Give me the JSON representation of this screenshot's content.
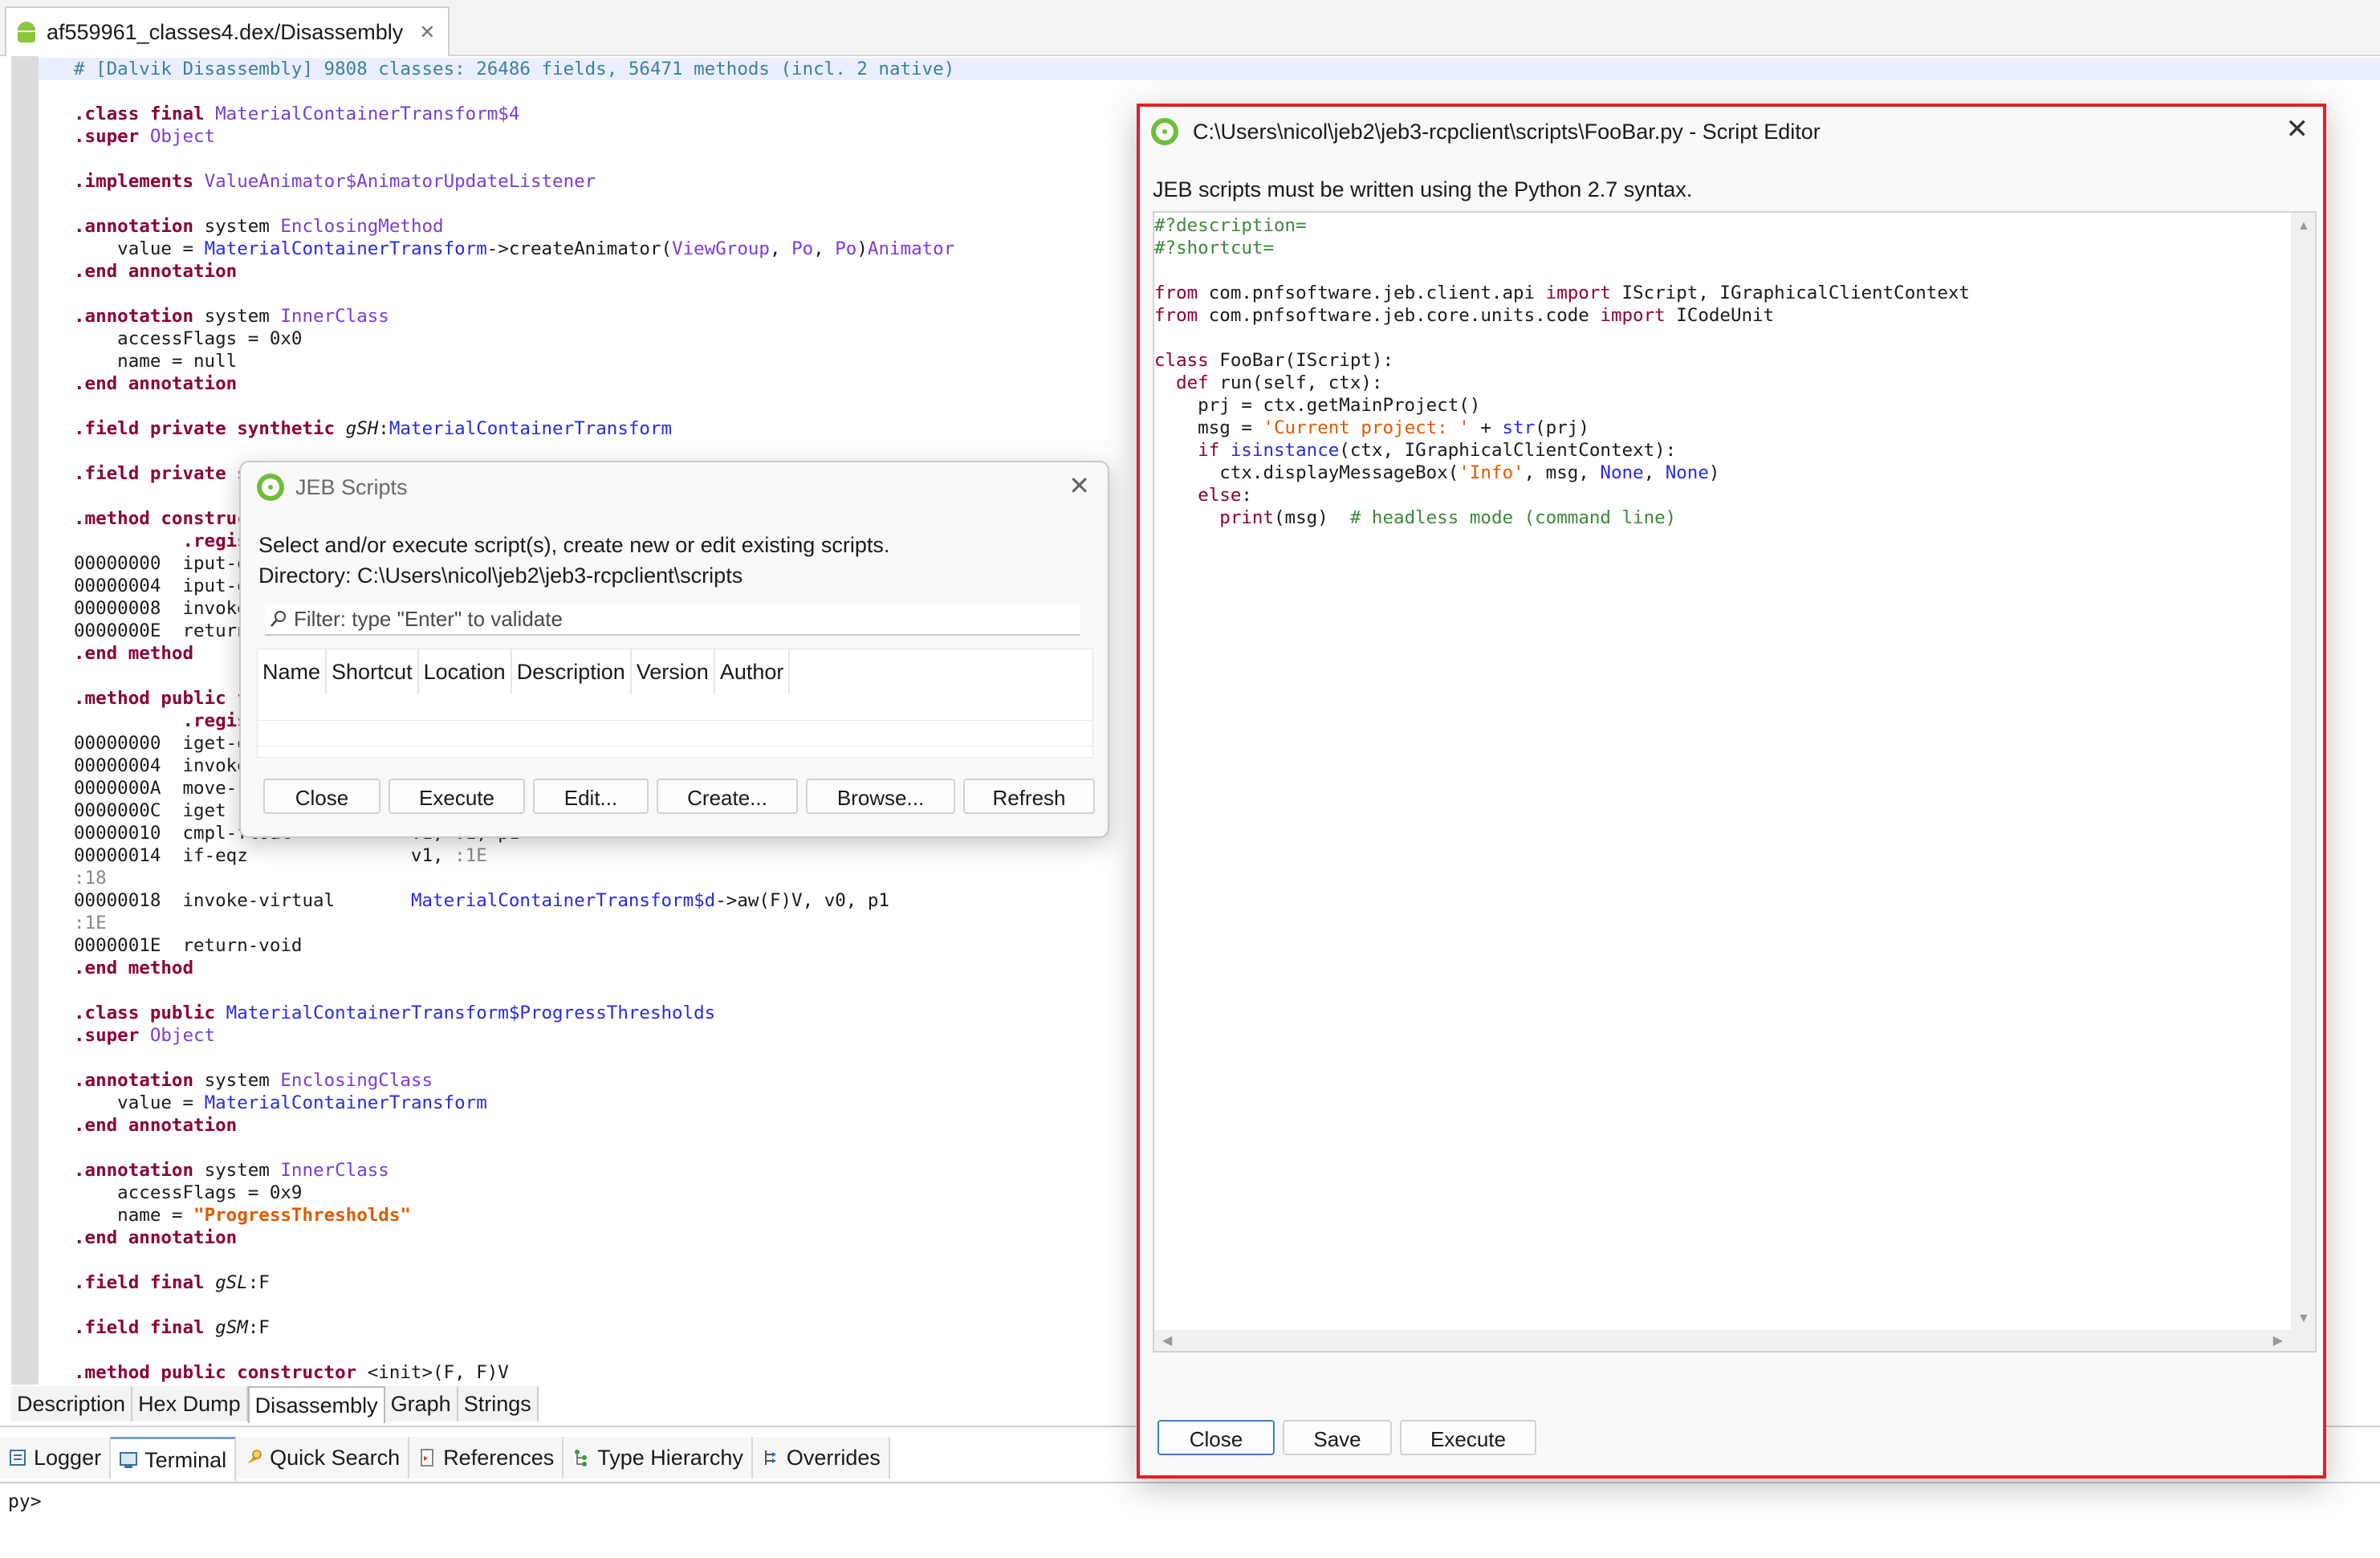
{
  "editor_tab": {
    "title": "af559961_classes4.dex/Disassembly",
    "close": "✕"
  },
  "code": {
    "lines": [
      [
        {
          "t": "# [Dalvik Disassembly] 9808 classes: 26486 fields, 56471 methods (incl. 2 native)",
          "c": "cmt"
        }
      ],
      [],
      [
        {
          "t": ".class final ",
          "c": "kw"
        },
        {
          "t": "MaterialContainerTransform$4",
          "c": "ty"
        }
      ],
      [
        {
          "t": ".super ",
          "c": "kw"
        },
        {
          "t": "Object",
          "c": "ty"
        }
      ],
      [],
      [
        {
          "t": ".implements ",
          "c": "kw"
        },
        {
          "t": "ValueAnimator$AnimatorUpdateListener",
          "c": "ty"
        }
      ],
      [],
      [
        {
          "t": ".annotation ",
          "c": "kw"
        },
        {
          "t": "system "
        },
        {
          "t": "EnclosingMethod",
          "c": "ty"
        }
      ],
      [
        {
          "t": "    value = "
        },
        {
          "t": "MaterialContainerTransform",
          "c": "sc"
        },
        {
          "t": "->createAnimator("
        },
        {
          "t": "ViewGroup",
          "c": "ty"
        },
        {
          "t": ", "
        },
        {
          "t": "Po",
          "c": "ty"
        },
        {
          "t": ", "
        },
        {
          "t": "Po",
          "c": "ty"
        },
        {
          "t": ")"
        },
        {
          "t": "Animator",
          "c": "ty"
        }
      ],
      [
        {
          "t": ".end annotation",
          "c": "kw"
        }
      ],
      [],
      [
        {
          "t": ".annotation ",
          "c": "kw"
        },
        {
          "t": "system "
        },
        {
          "t": "InnerClass",
          "c": "ty"
        }
      ],
      [
        {
          "t": "    accessFlags = 0x0"
        }
      ],
      [
        {
          "t": "    name = null"
        }
      ],
      [
        {
          "t": ".end annotation",
          "c": "kw"
        }
      ],
      [],
      [
        {
          "t": ".field private synthetic ",
          "c": "kw"
        },
        {
          "t": "gSH",
          "c": "mbr"
        },
        {
          "t": ":"
        },
        {
          "t": "MaterialContainerTransform",
          "c": "sc"
        }
      ],
      [],
      [
        {
          "t": ".field private s",
          "c": "kw"
        }
      ],
      [],
      [
        {
          "t": ".method construc",
          "c": "kw"
        }
      ],
      [
        {
          "t": "          .regis",
          "c": "kw"
        }
      ],
      [
        {
          "t": "00000000  iput-o"
        }
      ],
      [
        {
          "t": "00000004  iput-o                                                                                                 "
        },
        {
          "t": "d",
          "c": "sc"
        }
      ],
      [
        {
          "t": "00000008  invoke"
        }
      ],
      [
        {
          "t": "0000000E  return"
        }
      ],
      [
        {
          "t": ".end method",
          "c": "kw"
        }
      ],
      [],
      [
        {
          "t": ".method public f",
          "c": "kw"
        }
      ],
      [
        {
          "t": "          .regis",
          "c": "kw"
        }
      ],
      [
        {
          "t": "00000000  iget-o                                                                                                 "
        },
        {
          "t": "d",
          "c": "sc"
        }
      ],
      [
        {
          "t": "00000004  invoke"
        }
      ],
      [
        {
          "t": "0000000A  move-r"
        }
      ],
      [
        {
          "t": "0000000C  iget"
        }
      ],
      [
        {
          "t": "00000010  cmpl-float           v1, v1, p1"
        }
      ],
      [
        {
          "t": "00000014  if-eqz               v1, "
        },
        {
          "t": ":1E",
          "c": "lbl"
        }
      ],
      [
        {
          "t": ":18",
          "c": "lbl"
        }
      ],
      [
        {
          "t": "00000018  invoke-virtual       "
        },
        {
          "t": "MaterialContainerTransform$d",
          "c": "sc"
        },
        {
          "t": "->aw(F)V, v0, p1"
        }
      ],
      [
        {
          "t": ":1E",
          "c": "lbl"
        }
      ],
      [
        {
          "t": "0000001E  return-void"
        }
      ],
      [
        {
          "t": ".end method",
          "c": "kw"
        }
      ],
      [],
      [
        {
          "t": ".class public ",
          "c": "kw"
        },
        {
          "t": "MaterialContainerTransform$ProgressThresholds",
          "c": "sc"
        }
      ],
      [
        {
          "t": ".super ",
          "c": "kw"
        },
        {
          "t": "Object",
          "c": "ty"
        }
      ],
      [],
      [
        {
          "t": ".annotation ",
          "c": "kw"
        },
        {
          "t": "system "
        },
        {
          "t": "EnclosingClass",
          "c": "ty"
        }
      ],
      [
        {
          "t": "    value = "
        },
        {
          "t": "MaterialContainerTransform",
          "c": "sc"
        }
      ],
      [
        {
          "t": ".end annotation",
          "c": "kw"
        }
      ],
      [],
      [
        {
          "t": ".annotation ",
          "c": "kw"
        },
        {
          "t": "system "
        },
        {
          "t": "InnerClass",
          "c": "ty"
        }
      ],
      [
        {
          "t": "    accessFlags = 0x9"
        }
      ],
      [
        {
          "t": "    name = "
        },
        {
          "t": "\"ProgressThresholds\"",
          "c": "str"
        }
      ],
      [
        {
          "t": ".end annotation",
          "c": "kw"
        }
      ],
      [],
      [
        {
          "t": ".field final ",
          "c": "kw"
        },
        {
          "t": "gSL",
          "c": "mbr"
        },
        {
          "t": ":F"
        }
      ],
      [],
      [
        {
          "t": ".field final ",
          "c": "kw"
        },
        {
          "t": "gSM",
          "c": "mbr"
        },
        {
          "t": ":F"
        }
      ],
      [],
      [
        {
          "t": ".method public constructor ",
          "c": "kw"
        },
        {
          "t": "<init>(F, F)V"
        }
      ]
    ]
  },
  "view_tabs": {
    "description": "Description",
    "hex_dump": "Hex Dump",
    "disassembly": "Disassembly",
    "graph": "Graph",
    "strings": "Strings"
  },
  "panel_tabs": {
    "logger": "Logger",
    "terminal": "Terminal",
    "quick_search": "Quick Search",
    "references": "References",
    "type_hierarchy": "Type Hierarchy",
    "overrides": "Overrides"
  },
  "console": {
    "prompt": "py>"
  },
  "scripts_dialog": {
    "title": "JEB Scripts",
    "close": "✕",
    "desc_line1": "Select and/or execute script(s), create new or edit existing scripts.",
    "desc_line2": "Directory: C:\\Users\\nicol\\jeb2\\jeb3-rcpclient\\scripts",
    "filter_placeholder": "Filter: type \"Enter\" to validate",
    "columns": {
      "name": "Name",
      "shortcut": "Shortcut",
      "location": "Location",
      "description": "Description",
      "version": "Version",
      "author": "Author"
    },
    "buttons": {
      "close": "Close",
      "execute": "Execute",
      "edit": "Edit...",
      "create": "Create...",
      "browse": "Browse...",
      "refresh": "Refresh"
    }
  },
  "script_editor": {
    "title": "C:\\Users\\nicol\\jeb2\\jeb3-rcpclient\\scripts\\FooBar.py - Script Editor",
    "close": "✕",
    "info": "JEB scripts must be written using the Python 2.7 syntax.",
    "code_lines": [
      [
        {
          "t": "#?description=",
          "c": "pyc"
        }
      ],
      [
        {
          "t": "#?shortcut=",
          "c": "pyc"
        }
      ],
      [],
      [
        {
          "t": "from",
          "c": "pyk"
        },
        {
          "t": " com.pnfsoftware.jeb.client.api "
        },
        {
          "t": "import",
          "c": "pyk"
        },
        {
          "t": " IScript, IGraphicalClientContext"
        }
      ],
      [
        {
          "t": "from",
          "c": "pyk"
        },
        {
          "t": " com.pnfsoftware.jeb.core.units.code "
        },
        {
          "t": "import",
          "c": "pyk"
        },
        {
          "t": " ICodeUnit"
        }
      ],
      [],
      [
        {
          "t": "class",
          "c": "pyk"
        },
        {
          "t": " FooBar(IScript):"
        }
      ],
      [
        {
          "t": "  "
        },
        {
          "t": "def",
          "c": "pyk"
        },
        {
          "t": " run(self, ctx):"
        }
      ],
      [
        {
          "t": "    prj = ctx.getMainProject()"
        }
      ],
      [
        {
          "t": "    msg = "
        },
        {
          "t": "'Current project: '",
          "c": "pys"
        },
        {
          "t": " + "
        },
        {
          "t": "str",
          "c": "pyb"
        },
        {
          "t": "(prj)"
        }
      ],
      [
        {
          "t": "    "
        },
        {
          "t": "if",
          "c": "pyk"
        },
        {
          "t": " "
        },
        {
          "t": "isinstance",
          "c": "pyb"
        },
        {
          "t": "(ctx, IGraphicalClientContext):"
        }
      ],
      [
        {
          "t": "      ctx.displayMessageBox("
        },
        {
          "t": "'Info'",
          "c": "pys"
        },
        {
          "t": ", msg, "
        },
        {
          "t": "None",
          "c": "pyb"
        },
        {
          "t": ", "
        },
        {
          "t": "None",
          "c": "pyb"
        },
        {
          "t": ")"
        }
      ],
      [
        {
          "t": "    "
        },
        {
          "t": "else",
          "c": "pyk"
        },
        {
          "t": ":"
        }
      ],
      [
        {
          "t": "      "
        },
        {
          "t": "print",
          "c": "pyk"
        },
        {
          "t": "(msg)  "
        },
        {
          "t": "# headless mode (command line)",
          "c": "pyc"
        }
      ]
    ],
    "buttons": {
      "close": "Close",
      "save": "Save",
      "execute": "Execute"
    }
  },
  "colors": {
    "highlight_border": "#e0202a",
    "jeb_logo": "#6cbf3a",
    "android": "#8dc63f"
  }
}
